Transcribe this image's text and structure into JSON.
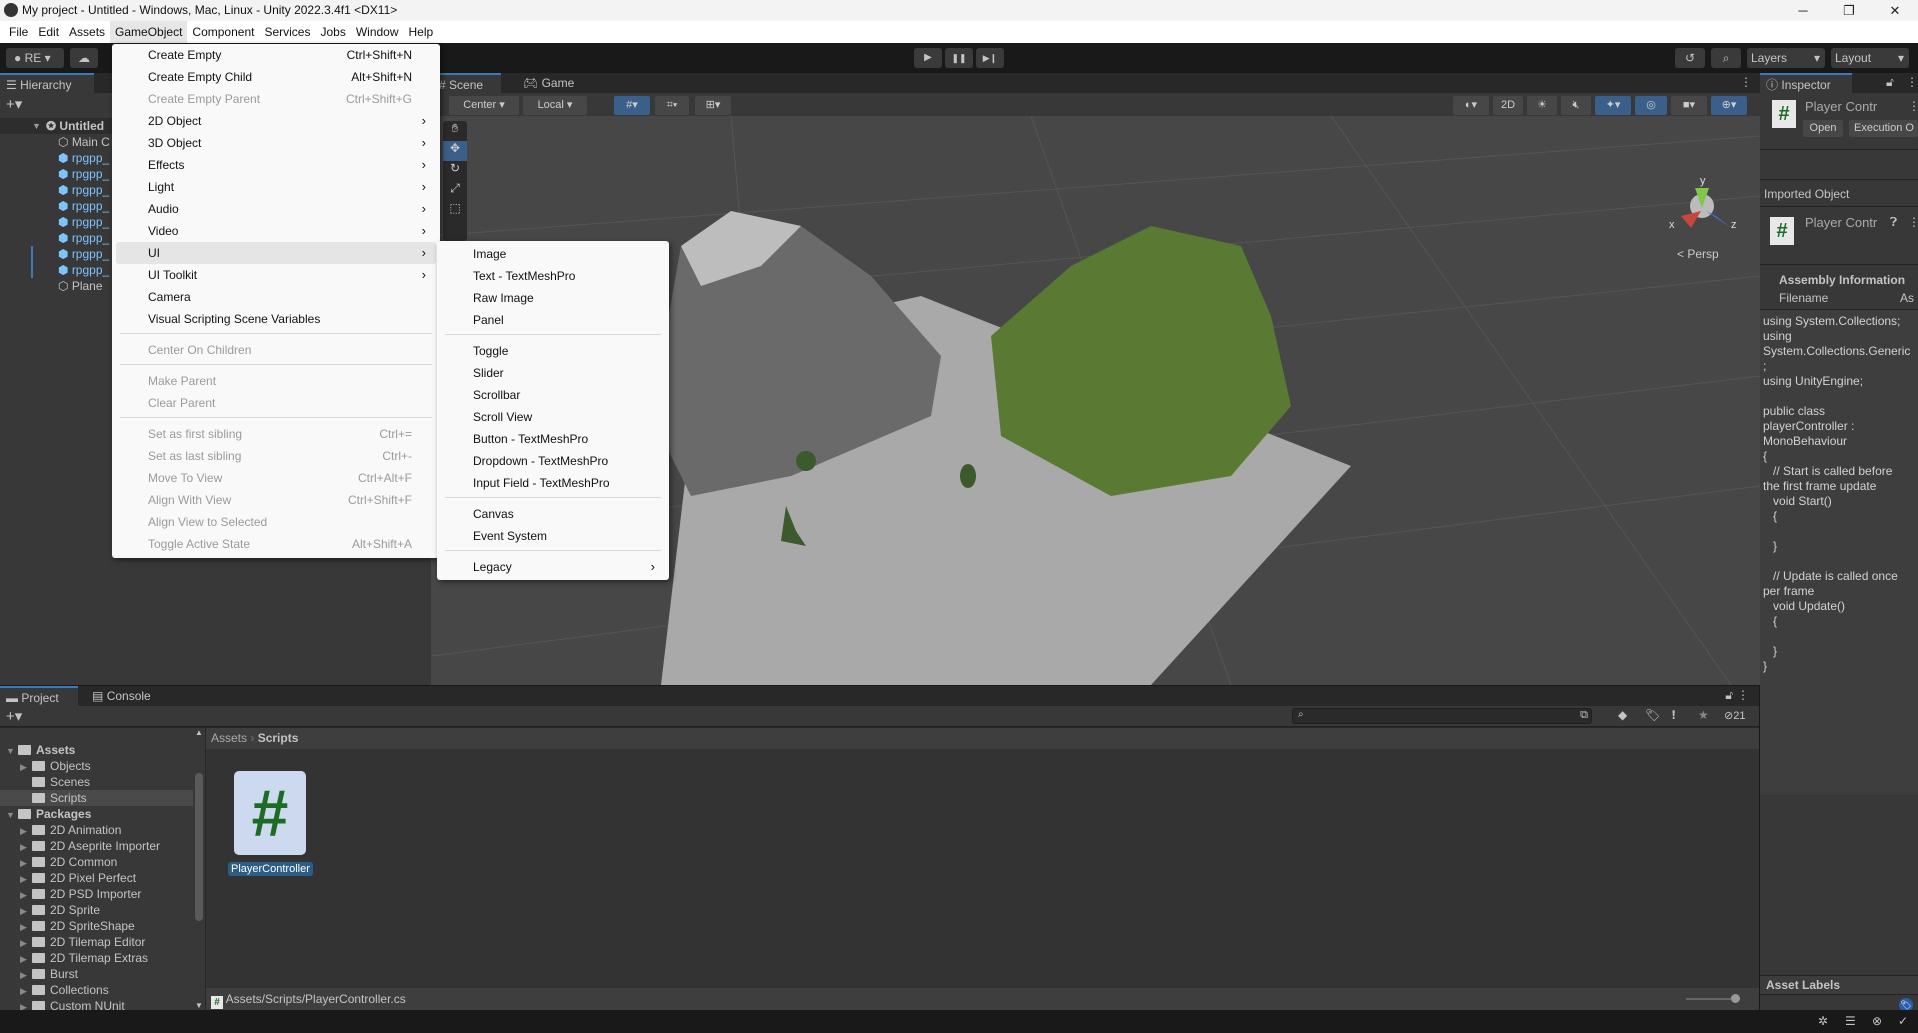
{
  "window": {
    "title": "My project - Untitled - Windows, Mac, Linux - Unity 2022.3.4f1 <DX11>",
    "minimize": "─",
    "maximize": "❐",
    "close": "✕"
  },
  "menubar": [
    "File",
    "Edit",
    "Assets",
    "GameObject",
    "Component",
    "Services",
    "Jobs",
    "Window",
    "Help"
  ],
  "toolbar": {
    "account": "RE",
    "layers": "Layers",
    "layout": "Layout",
    "play": "▶",
    "pause": "❚❚",
    "step": "▶❙"
  },
  "hierarchy": {
    "tab": "Hierarchy",
    "scene": "Untitled",
    "items": [
      {
        "label": "Main C",
        "type": "plain"
      },
      {
        "label": "rpgpp_",
        "type": "prefab"
      },
      {
        "label": "rpgpp_",
        "type": "prefab"
      },
      {
        "label": "rpgpp_",
        "type": "prefab"
      },
      {
        "label": "rpgpp_",
        "type": "prefab"
      },
      {
        "label": "rpgpp_",
        "type": "prefab"
      },
      {
        "label": "rpgpp_",
        "type": "prefab"
      },
      {
        "label": "rpgpp_",
        "type": "prefab"
      },
      {
        "label": "rpgpp_",
        "type": "prefab"
      },
      {
        "label": "Plane",
        "type": "plain"
      }
    ]
  },
  "gameobject_menu": [
    {
      "label": "Create Empty",
      "shortcut": "Ctrl+Shift+N"
    },
    {
      "label": "Create Empty Child",
      "shortcut": "Alt+Shift+N"
    },
    {
      "label": "Create Empty Parent",
      "shortcut": "Ctrl+Shift+G",
      "disabled": true
    },
    {
      "label": "2D Object",
      "submenu": true
    },
    {
      "label": "3D Object",
      "submenu": true
    },
    {
      "label": "Effects",
      "submenu": true
    },
    {
      "label": "Light",
      "submenu": true
    },
    {
      "label": "Audio",
      "submenu": true
    },
    {
      "label": "Video",
      "submenu": true
    },
    {
      "label": "UI",
      "submenu": true,
      "highlighted": true
    },
    {
      "label": "UI Toolkit",
      "submenu": true
    },
    {
      "label": "Camera"
    },
    {
      "label": "Visual Scripting Scene Variables"
    },
    {
      "label": "Center On Children",
      "disabled": true,
      "sep": true
    },
    {
      "label": "Make Parent",
      "disabled": true,
      "sep": true
    },
    {
      "label": "Clear Parent",
      "disabled": true
    },
    {
      "label": "Set as first sibling",
      "shortcut": "Ctrl+=",
      "disabled": true,
      "sep": true
    },
    {
      "label": "Set as last sibling",
      "shortcut": "Ctrl+-",
      "disabled": true
    },
    {
      "label": "Move To View",
      "shortcut": "Ctrl+Alt+F",
      "disabled": true
    },
    {
      "label": "Align With View",
      "shortcut": "Ctrl+Shift+F",
      "disabled": true
    },
    {
      "label": "Align View to Selected",
      "disabled": true
    },
    {
      "label": "Toggle Active State",
      "shortcut": "Alt+Shift+A",
      "disabled": true
    }
  ],
  "ui_submenu": [
    {
      "label": "Image"
    },
    {
      "label": "Text - TextMeshPro"
    },
    {
      "label": "Raw Image"
    },
    {
      "label": "Panel"
    },
    {
      "label": "Toggle",
      "sep": true
    },
    {
      "label": "Slider"
    },
    {
      "label": "Scrollbar"
    },
    {
      "label": "Scroll View"
    },
    {
      "label": "Button - TextMeshPro"
    },
    {
      "label": "Dropdown - TextMeshPro"
    },
    {
      "label": "Input Field - TextMeshPro"
    },
    {
      "label": "Canvas",
      "sep": true
    },
    {
      "label": "Event System"
    },
    {
      "label": "Legacy",
      "submenu": true,
      "sep": true
    }
  ],
  "scene": {
    "tabs": [
      "Scene",
      "Game"
    ],
    "pivot": "Center",
    "space": "Local",
    "mode_2d": "2D",
    "persp": "< Persp",
    "axes": [
      "x",
      "y",
      "z"
    ]
  },
  "inspector": {
    "tab": "Inspector",
    "title": "Player Contr",
    "open": "Open",
    "execution": "Execution O",
    "imported": "Imported Object",
    "sub_title": "Player Contr",
    "assembly": "Assembly Information",
    "filename_label": "Filename",
    "filename_value": "As",
    "code": "using System.Collections;\nusing\nSystem.Collections.Generic\n;\nusing UnityEngine;\n\npublic class\nplayerController :\nMonoBehaviour\n{\n   // Start is called before\nthe first frame update\n   void Start()\n   {\n\n   }\n\n   // Update is called once\nper frame\n   void Update()\n   {\n\n   }\n}",
    "asset_labels": "Asset Labels"
  },
  "project": {
    "tabs": [
      "Project",
      "Console"
    ],
    "breadcrumb": [
      "Assets",
      "Scripts"
    ],
    "hidden_count": "21",
    "file": "PlayerController",
    "path": "Assets/Scripts/PlayerController.cs",
    "tree": [
      {
        "label": "Assets",
        "level": 0,
        "open": true,
        "bold": true
      },
      {
        "label": "Objects",
        "level": 1,
        "arrow": true
      },
      {
        "label": "Scenes",
        "level": 1
      },
      {
        "label": "Scripts",
        "level": 1,
        "selected": true
      },
      {
        "label": "Packages",
        "level": 0,
        "open": true,
        "bold": true
      },
      {
        "label": "2D Animation",
        "level": 1,
        "arrow": true
      },
      {
        "label": "2D Aseprite Importer",
        "level": 1,
        "arrow": true
      },
      {
        "label": "2D Common",
        "level": 1,
        "arrow": true
      },
      {
        "label": "2D Pixel Perfect",
        "level": 1,
        "arrow": true
      },
      {
        "label": "2D PSD Importer",
        "level": 1,
        "arrow": true
      },
      {
        "label": "2D Sprite",
        "level": 1,
        "arrow": true
      },
      {
        "label": "2D SpriteShape",
        "level": 1,
        "arrow": true
      },
      {
        "label": "2D Tilemap Editor",
        "level": 1,
        "arrow": true
      },
      {
        "label": "2D Tilemap Extras",
        "level": 1,
        "arrow": true
      },
      {
        "label": "Burst",
        "level": 1,
        "arrow": true
      },
      {
        "label": "Collections",
        "level": 1,
        "arrow": true
      },
      {
        "label": "Custom NUnit",
        "level": 1,
        "arrow": true
      }
    ]
  },
  "colors": {
    "accent": "#3a79bb",
    "prefab": "#7cc3ff",
    "script_green": "#1e6b24",
    "selection": "#2c5d87"
  }
}
